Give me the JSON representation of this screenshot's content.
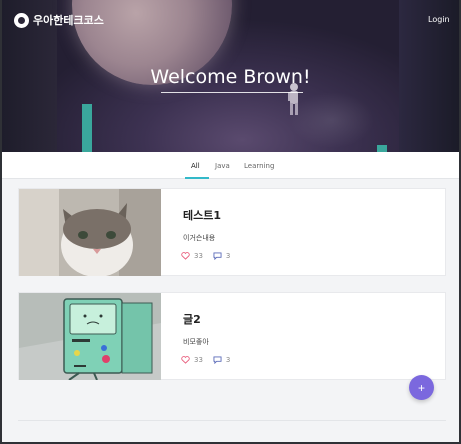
{
  "header": {
    "brand": "우아한테크코스",
    "login_label": "Login",
    "welcome_text": "Welcome Brown!"
  },
  "tabs": [
    {
      "label": "All",
      "active": true
    },
    {
      "label": "Java",
      "active": false
    },
    {
      "label": "Learning",
      "active": false
    }
  ],
  "posts": [
    {
      "title": "테스트1",
      "body": "이거슨내용",
      "likes": "33",
      "comments": "3",
      "thumbnail": "cat-photo"
    },
    {
      "title": "글2",
      "body": "비모좋아",
      "likes": "33",
      "comments": "3",
      "thumbnail": "bmo-illustration"
    }
  ],
  "fab": {
    "label": "+"
  },
  "colors": {
    "accent": "#33b9c9",
    "fab": "#7b68de",
    "like": "#e85a7a",
    "comment": "#5a6ab8"
  }
}
